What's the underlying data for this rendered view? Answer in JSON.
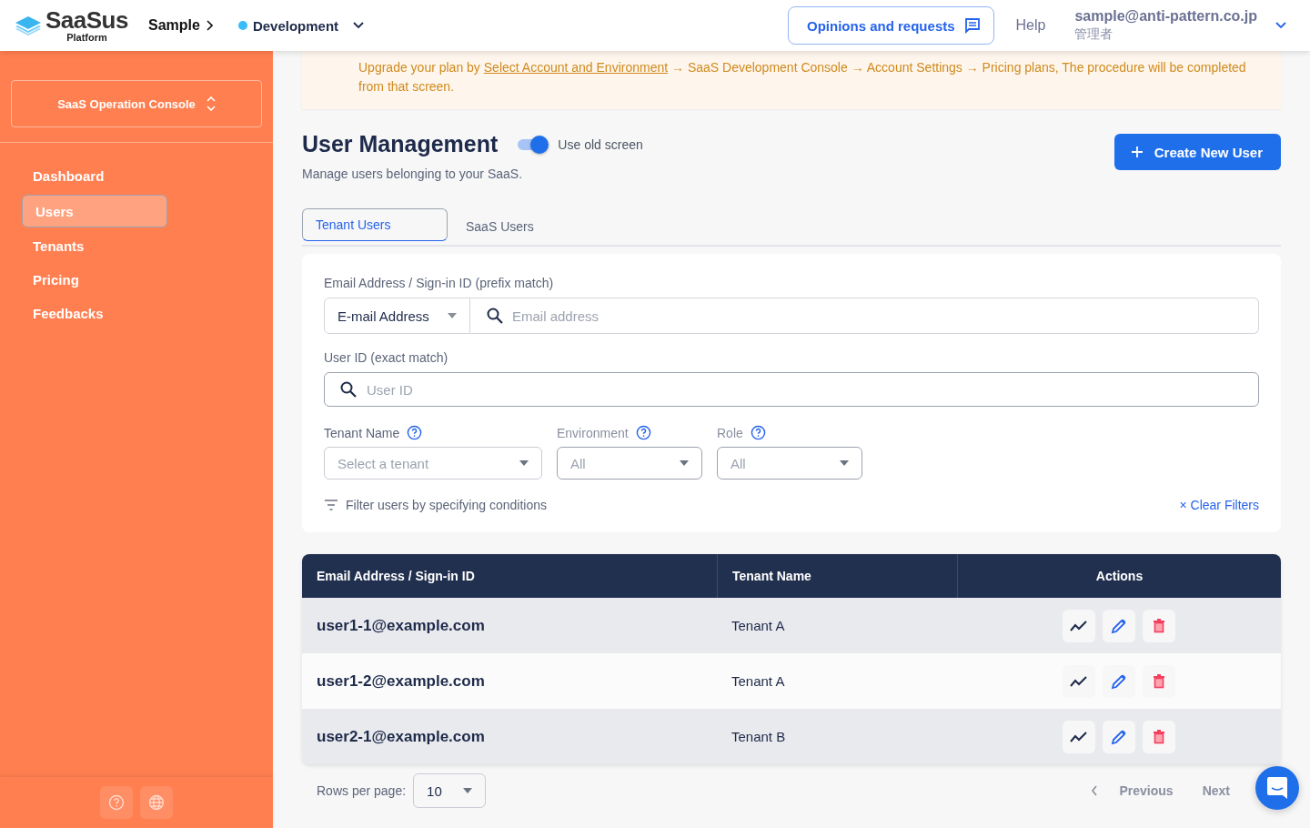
{
  "header": {
    "logo": {
      "name": "SaaSus",
      "sub": "Platform"
    },
    "breadcrumb": "Sample",
    "environment": {
      "label": "Development",
      "color": "#38bdf8"
    },
    "feedback_button": "Opinions and requests",
    "help": "Help",
    "user": {
      "email": "sample@anti-pattern.co.jp",
      "role": "管理者"
    }
  },
  "sidebar": {
    "console_switcher": "SaaS Operation Console",
    "items": [
      {
        "label": "Dashboard",
        "selected": false
      },
      {
        "label": "Users",
        "selected": true
      },
      {
        "label": "Tenants",
        "selected": false
      },
      {
        "label": "Pricing",
        "selected": false
      },
      {
        "label": "Feedbacks",
        "selected": false
      }
    ]
  },
  "notice": {
    "before": "Upgrade your plan by",
    "link": "Select Account and Environment",
    "after": "→ SaaS Development Console → Account Settings → Pricing plans, The procedure will be completed from that screen."
  },
  "page": {
    "title": "User Management",
    "toggle": {
      "label": "Use old screen",
      "on": true
    },
    "subtitle": "Manage users belonging to your SaaS.",
    "create_button": "Create New User"
  },
  "tabs": [
    {
      "label": "Tenant Users",
      "selected": true
    },
    {
      "label": "SaaS Users",
      "selected": false
    }
  ],
  "filters": {
    "email_label": "Email Address / Sign-in ID (prefix match)",
    "email_type": "E-mail Address",
    "email_placeholder": "Email address",
    "user_id_label": "User ID (exact match)",
    "user_id_placeholder": "User ID",
    "selects": [
      {
        "label": "Tenant Name",
        "placeholder": "Select a tenant"
      },
      {
        "label": "Environment",
        "placeholder": "All"
      },
      {
        "label": "Role",
        "placeholder": "All"
      }
    ],
    "hint": "Filter users by specifying conditions",
    "clear_mark": "×",
    "clear": "Clear Filters"
  },
  "table": {
    "columns": [
      "Email Address / Sign-in ID",
      "Tenant Name",
      "Actions"
    ],
    "rows": [
      {
        "email": "user1-1@example.com",
        "tenant": "Tenant A"
      },
      {
        "email": "user1-2@example.com",
        "tenant": "Tenant A"
      },
      {
        "email": "user2-1@example.com",
        "tenant": "Tenant B"
      }
    ]
  },
  "pagination": {
    "rows_per_page_label": "Rows per page:",
    "rows_per_page": "10",
    "previous": "Previous",
    "next": "Next"
  }
}
